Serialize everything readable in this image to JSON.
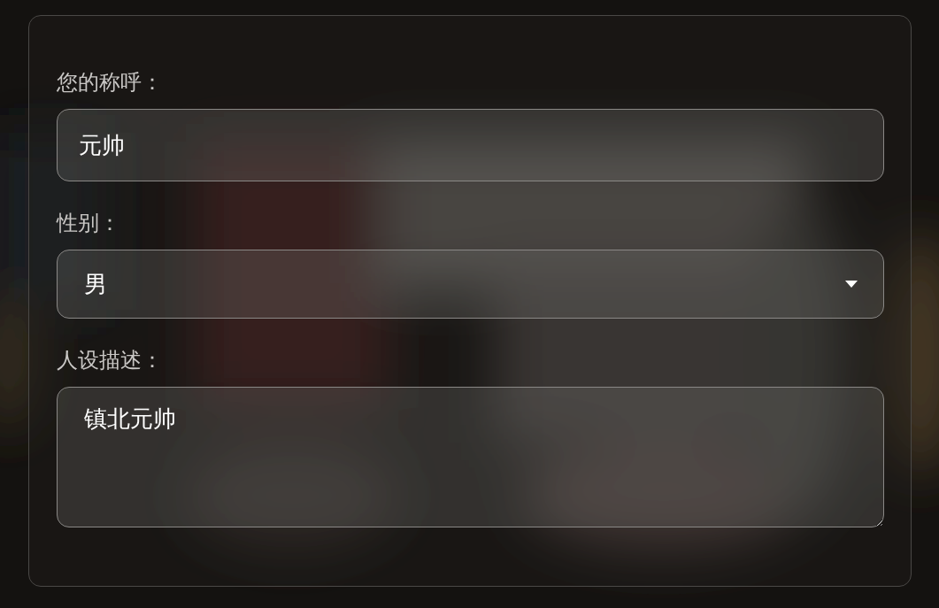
{
  "fields": [
    {
      "kind": "text",
      "label": "您的称呼：",
      "value": "元帅"
    },
    {
      "kind": "select",
      "label": "性别：",
      "value": "男"
    },
    {
      "kind": "textarea",
      "label": "人设描述：",
      "value": "镇北元帅"
    }
  ]
}
